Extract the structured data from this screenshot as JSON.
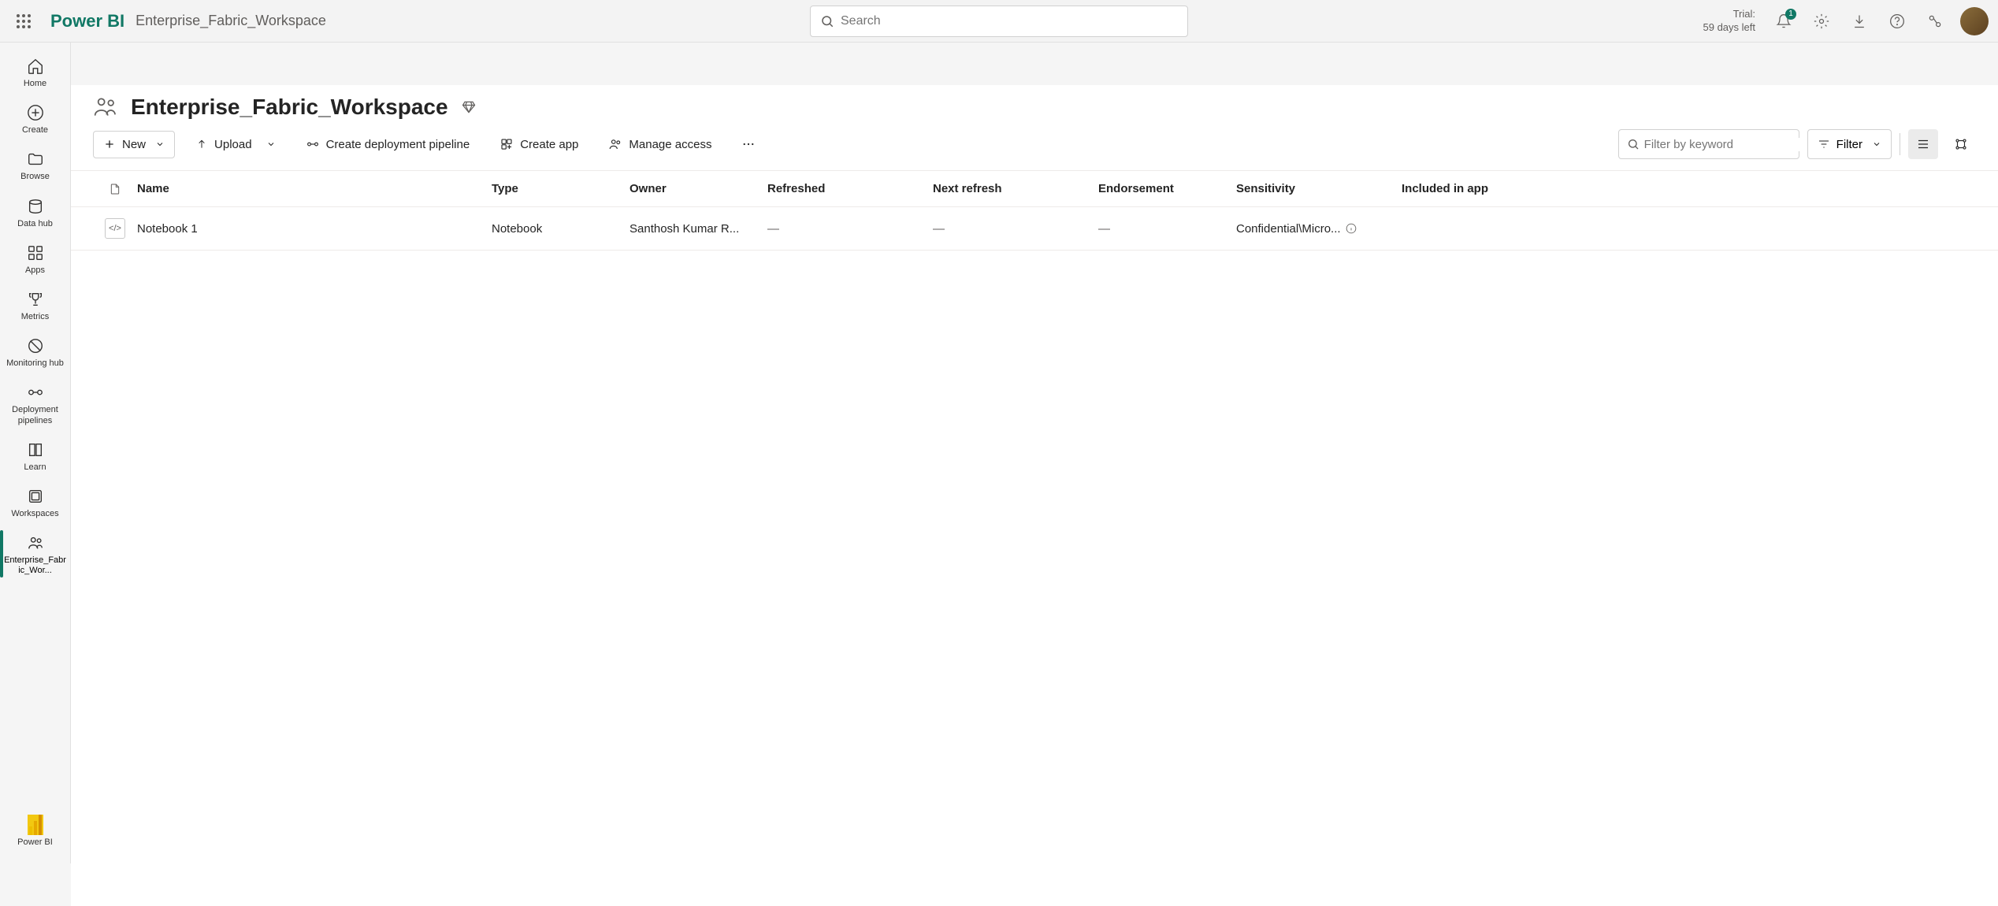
{
  "header": {
    "product": "Power BI",
    "breadcrumb": "Enterprise_Fabric_Workspace",
    "search_placeholder": "Search",
    "trial_label": "Trial:",
    "trial_days": "59 days left",
    "notification_count": "1"
  },
  "sidebar": {
    "items": [
      {
        "label": "Home"
      },
      {
        "label": "Create"
      },
      {
        "label": "Browse"
      },
      {
        "label": "Data hub"
      },
      {
        "label": "Apps"
      },
      {
        "label": "Metrics"
      },
      {
        "label": "Monitoring hub"
      },
      {
        "label": "Deployment pipelines"
      },
      {
        "label": "Learn"
      },
      {
        "label": "Workspaces"
      },
      {
        "label": "Enterprise_Fabric_Wor..."
      }
    ],
    "bottom_label": "Power BI"
  },
  "workspace": {
    "title": "Enterprise_Fabric_Workspace"
  },
  "toolbar": {
    "new_label": "New",
    "upload_label": "Upload",
    "pipeline_label": "Create deployment pipeline",
    "create_app_label": "Create app",
    "manage_access_label": "Manage access",
    "filter_placeholder": "Filter by keyword",
    "filter_label": "Filter"
  },
  "table": {
    "headers": {
      "name": "Name",
      "type": "Type",
      "owner": "Owner",
      "refreshed": "Refreshed",
      "next_refresh": "Next refresh",
      "endorsement": "Endorsement",
      "sensitivity": "Sensitivity",
      "included": "Included in app"
    },
    "rows": [
      {
        "name": "Notebook 1",
        "type": "Notebook",
        "owner": "Santhosh Kumar R...",
        "refreshed": "—",
        "next_refresh": "—",
        "endorsement": "—",
        "sensitivity": "Confidential\\Micro...",
        "included": ""
      }
    ]
  }
}
